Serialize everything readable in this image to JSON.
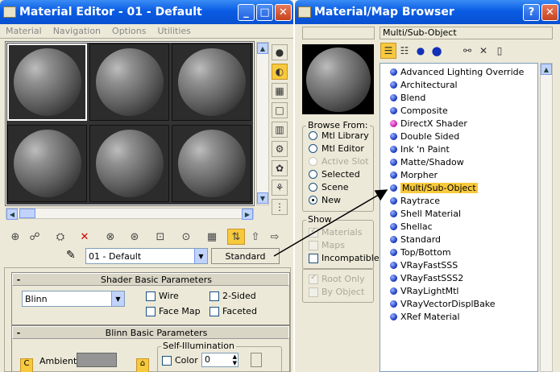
{
  "material_editor": {
    "title": "Material Editor - 01 - Default",
    "menu": [
      "Material",
      "Navigation",
      "Options",
      "Utilities"
    ],
    "material_name": "01 - Default",
    "type_button": "Standard",
    "shader_rollout": {
      "title": "Shader Basic Parameters",
      "shader": "Blinn",
      "wire": "Wire",
      "two_sided": "2-Sided",
      "face_map": "Face Map",
      "faceted": "Faceted"
    },
    "blinn_rollout": {
      "title": "Blinn Basic Parameters",
      "ambient": "Ambient:",
      "self_illum": "Self-Illumination",
      "color": "Color",
      "color_value": "0"
    }
  },
  "map_browser": {
    "title": "Material/Map Browser",
    "selected_name": "Multi/Sub-Object",
    "browse_from": {
      "label": "Browse From:",
      "options": [
        {
          "label": "Mtl Library",
          "selected": false,
          "enabled": true
        },
        {
          "label": "Mtl Editor",
          "selected": false,
          "enabled": true
        },
        {
          "label": "Active Slot",
          "selected": false,
          "enabled": false
        },
        {
          "label": "Selected",
          "selected": false,
          "enabled": true
        },
        {
          "label": "Scene",
          "selected": false,
          "enabled": true
        },
        {
          "label": "New",
          "selected": true,
          "enabled": true
        }
      ]
    },
    "show": {
      "label": "Show",
      "options": [
        {
          "label": "Materials",
          "checked": true,
          "enabled": false
        },
        {
          "label": "Maps",
          "checked": false,
          "enabled": false
        },
        {
          "label": "Incompatible",
          "checked": false,
          "enabled": true
        }
      ]
    },
    "root_only": "Root Only",
    "by_object": "By Object",
    "items": [
      {
        "label": "Advanced Lighting Override",
        "color": "blue"
      },
      {
        "label": "Architectural",
        "color": "blue"
      },
      {
        "label": "Blend",
        "color": "blue"
      },
      {
        "label": "Composite",
        "color": "blue"
      },
      {
        "label": "DirectX Shader",
        "color": "pink"
      },
      {
        "label": "Double Sided",
        "color": "blue"
      },
      {
        "label": "Ink 'n Paint",
        "color": "blue"
      },
      {
        "label": "Matte/Shadow",
        "color": "blue"
      },
      {
        "label": "Morpher",
        "color": "blue"
      },
      {
        "label": "Multi/Sub-Object",
        "color": "blue",
        "selected": true
      },
      {
        "label": "Raytrace",
        "color": "blue"
      },
      {
        "label": "Shell Material",
        "color": "blue"
      },
      {
        "label": "Shellac",
        "color": "blue"
      },
      {
        "label": "Standard",
        "color": "blue"
      },
      {
        "label": "Top/Bottom",
        "color": "blue"
      },
      {
        "label": "VRayFastSSS",
        "color": "blue"
      },
      {
        "label": "VRayFastSSS2",
        "color": "blue"
      },
      {
        "label": "VRayLightMtl",
        "color": "blue"
      },
      {
        "label": "VRayVectorDisplBake",
        "color": "blue"
      },
      {
        "label": "XRef Material",
        "color": "blue"
      }
    ]
  },
  "icons": [
    "minimize-icon",
    "maximize-icon",
    "close-icon",
    "help-icon",
    "arrow-annotation"
  ],
  "colors": {
    "title_blue": "#0a5ce4",
    "highlight": "#f7c93d",
    "arrow": "#000000"
  }
}
